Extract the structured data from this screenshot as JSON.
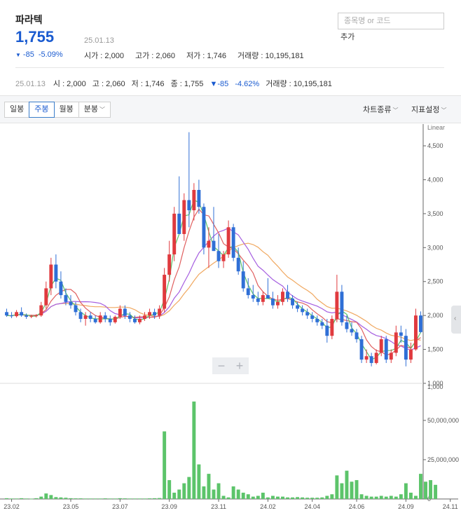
{
  "stock": {
    "name": "파라텍",
    "price": "1,755",
    "date": "25.01.13",
    "change_arrow": "▼",
    "change": "-85",
    "change_pct": "-5.09%"
  },
  "stats": {
    "open": "시가 : 2,000",
    "high": "고가 : 2,060",
    "low": "저가 : 1,746",
    "volume": "거래량 : 10,195,181"
  },
  "search": {
    "placeholder": "종목명 or 코드",
    "add_label": "추가"
  },
  "summary": {
    "date": "25.01.13",
    "open": "시 : 2,000",
    "high": "고 : 2,060",
    "low": "저 : 1,746",
    "close": "종 : 1,755",
    "change": "▼-85",
    "change_pct": "-4.62%",
    "volume": "거래량 : 10,195,181"
  },
  "toolbar": {
    "periods": [
      "일봉",
      "주봉",
      "월봉",
      "분봉"
    ],
    "active_period": "주봉",
    "chart_type": "차트종류",
    "indicator": "지표설정"
  },
  "chart_data": {
    "type": "candlestick",
    "scale": "Linear",
    "price_axis": {
      "ticks": [
        "1,000",
        "1,500",
        "2,000",
        "2,500",
        "3,000",
        "3,500",
        "4,000",
        "4,500"
      ],
      "range": [
        1000,
        4800
      ]
    },
    "volume_axis": {
      "ticks": [
        "0",
        "25,000,000",
        "50,000,000"
      ],
      "range": [
        0,
        70000000
      ]
    },
    "x_ticks": [
      "23.02",
      "23.05",
      "23.07",
      "23.09",
      "23.11",
      "24.02",
      "24.04",
      "24.06",
      "24.09",
      "24.11"
    ],
    "x_tick_index": [
      1,
      13,
      23,
      33,
      43,
      53,
      62,
      71,
      81,
      90
    ],
    "colors": {
      "up": "#e03a3e",
      "down": "#2f6fd6",
      "volume": "#5cc46a",
      "ma5": "#5cc46a",
      "ma20": "#e06060",
      "ma60": "#a55ee0",
      "ma120": "#f0a860"
    },
    "candles": [
      [
        2050,
        2100,
        1980,
        2000
      ],
      [
        2000,
        2050,
        1960,
        1990
      ],
      [
        1990,
        2080,
        1970,
        2050
      ],
      [
        2050,
        2120,
        1980,
        2000
      ],
      [
        2000,
        2030,
        1950,
        1980
      ],
      [
        1980,
        2010,
        1960,
        1990
      ],
      [
        1990,
        2020,
        1970,
        2000
      ],
      [
        2000,
        2200,
        1980,
        2150
      ],
      [
        2150,
        2500,
        2100,
        2400
      ],
      [
        2400,
        2850,
        2300,
        2750
      ],
      [
        2750,
        2900,
        2400,
        2500
      ],
      [
        2500,
        2650,
        2250,
        2300
      ],
      [
        2300,
        2400,
        2150,
        2200
      ],
      [
        2200,
        2300,
        2100,
        2150
      ],
      [
        2150,
        2200,
        2000,
        2050
      ],
      [
        2050,
        2100,
        1900,
        1950
      ],
      [
        1950,
        2050,
        1850,
        2000
      ],
      [
        2000,
        2050,
        1900,
        1950
      ],
      [
        1950,
        2000,
        1880,
        1900
      ],
      [
        1900,
        2050,
        1880,
        2000
      ],
      [
        2000,
        2050,
        1900,
        1950
      ],
      [
        1950,
        2000,
        1850,
        1900
      ],
      [
        1900,
        2000,
        1880,
        1980
      ],
      [
        1980,
        2150,
        1950,
        2100
      ],
      [
        2100,
        2150,
        1950,
        2000
      ],
      [
        2000,
        2050,
        1900,
        1950
      ],
      [
        1950,
        2000,
        1880,
        1900
      ],
      [
        1900,
        2000,
        1870,
        1950
      ],
      [
        1950,
        2050,
        1920,
        2000
      ],
      [
        2000,
        2100,
        1950,
        2050
      ],
      [
        2050,
        2100,
        1950,
        2000
      ],
      [
        2000,
        2150,
        1950,
        2100
      ],
      [
        2100,
        2700,
        2050,
        2600
      ],
      [
        2600,
        3100,
        2500,
        2900
      ],
      [
        2900,
        3600,
        2800,
        3500
      ],
      [
        3500,
        4050,
        3200,
        3200
      ],
      [
        3200,
        3800,
        3100,
        3700
      ],
      [
        3700,
        4700,
        3300,
        3550
      ],
      [
        3550,
        3950,
        3400,
        3850
      ],
      [
        3850,
        4000,
        3500,
        3600
      ],
      [
        3600,
        3650,
        2900,
        3000
      ],
      [
        3000,
        3300,
        2700,
        3100
      ],
      [
        3100,
        3600,
        2950,
        2950
      ],
      [
        2950,
        3200,
        2700,
        2800
      ],
      [
        2800,
        2950,
        2700,
        2900
      ],
      [
        2900,
        3400,
        2850,
        3300
      ],
      [
        3300,
        3350,
        2800,
        2850
      ],
      [
        2850,
        3000,
        2600,
        2650
      ],
      [
        2650,
        2800,
        2350,
        2400
      ],
      [
        2400,
        2550,
        2250,
        2300
      ],
      [
        2300,
        2450,
        2200,
        2250
      ],
      [
        2250,
        2350,
        2150,
        2200
      ],
      [
        2200,
        2350,
        2150,
        2300
      ],
      [
        2300,
        2550,
        2250,
        2250
      ],
      [
        2250,
        2350,
        2100,
        2150
      ],
      [
        2150,
        2300,
        2100,
        2200
      ],
      [
        2200,
        2400,
        2150,
        2350
      ],
      [
        2350,
        2450,
        2200,
        2250
      ],
      [
        2250,
        2300,
        2100,
        2150
      ],
      [
        2150,
        2200,
        2050,
        2100
      ],
      [
        2100,
        2150,
        2000,
        2050
      ],
      [
        2050,
        2100,
        1950,
        2000
      ],
      [
        2000,
        2050,
        1900,
        1950
      ],
      [
        1950,
        2000,
        1850,
        1900
      ],
      [
        1900,
        1950,
        1800,
        1850
      ],
      [
        1850,
        1950,
        1600,
        1700
      ],
      [
        1700,
        2000,
        1650,
        1950
      ],
      [
        1950,
        2600,
        1900,
        2350
      ],
      [
        2350,
        2450,
        1850,
        1900
      ],
      [
        1900,
        2000,
        1750,
        1800
      ],
      [
        1800,
        1900,
        1700,
        1750
      ],
      [
        1750,
        1800,
        1600,
        1650
      ],
      [
        1650,
        1700,
        1300,
        1350
      ],
      [
        1350,
        1500,
        1300,
        1400
      ],
      [
        1400,
        1450,
        1250,
        1300
      ],
      [
        1300,
        1500,
        1280,
        1450
      ],
      [
        1450,
        1700,
        1400,
        1650
      ],
      [
        1650,
        1700,
        1300,
        1350
      ],
      [
        1350,
        1500,
        1300,
        1450
      ],
      [
        1450,
        1850,
        1400,
        1750
      ],
      [
        1750,
        1850,
        1600,
        1700
      ],
      [
        1700,
        1800,
        1250,
        1350
      ],
      [
        1350,
        1600,
        1300,
        1500
      ],
      [
        1500,
        2100,
        1480,
        2000
      ],
      [
        2000,
        2060,
        1746,
        1755
      ]
    ],
    "volumes": [
      0.5,
      0.3,
      0.3,
      0.5,
      0.3,
      0.2,
      0.5,
      1.5,
      3.5,
      2.5,
      1.2,
      1.0,
      0.8,
      0.5,
      0.4,
      0.4,
      0.3,
      0.3,
      0.3,
      0.3,
      0.4,
      0.3,
      0.3,
      0.5,
      0.4,
      0.3,
      0.3,
      0.3,
      0.3,
      0.4,
      0.5,
      0.6,
      43,
      12,
      4,
      6,
      10,
      14,
      62,
      22,
      8,
      16,
      6,
      10,
      2,
      1,
      8,
      6,
      4,
      3,
      1.5,
      2,
      4,
      1,
      2,
      1.5,
      1.5,
      1,
      1,
      1.2,
      1,
      0.8,
      0.8,
      0.8,
      1,
      2,
      3,
      15,
      10,
      18,
      11,
      12,
      3,
      2,
      1.5,
      1.5,
      2,
      1.5,
      2,
      1.5,
      3,
      10,
      4,
      2,
      16,
      11,
      12,
      9
    ]
  }
}
